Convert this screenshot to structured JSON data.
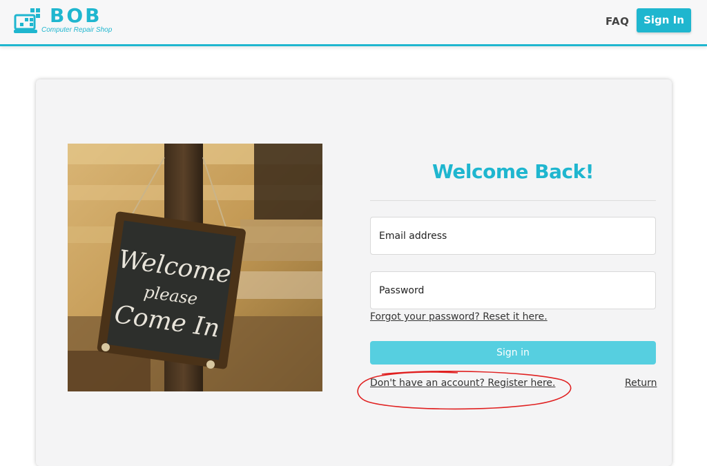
{
  "colors": {
    "accent": "#1fb6cf",
    "button_light": "#56cfe0",
    "annotation": "#e02020"
  },
  "header": {
    "logo_name": "BOB",
    "logo_tagline": "Computer Repair Shop",
    "logo_icon": "laptop-pixel-icon",
    "faq_label": "FAQ",
    "signin_label": "Sign In"
  },
  "photo": {
    "description_icon": "welcome-sign-photo"
  },
  "form": {
    "title": "Welcome Back!",
    "email_placeholder": "Email address",
    "password_placeholder": "Password",
    "forgot_link": "Forgot your password? Reset it here.",
    "submit_label": "Sign in",
    "register_link": "Don't have an account? Register here.",
    "return_link": "Return"
  }
}
